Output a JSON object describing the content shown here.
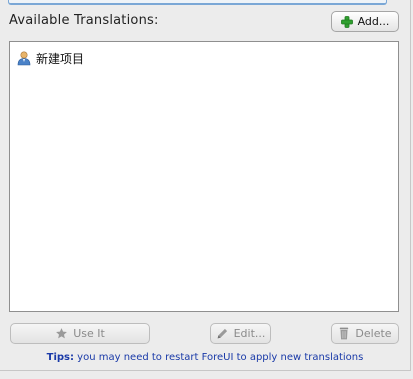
{
  "header": {
    "section_label": "Available Translations:",
    "add_label": "Add..."
  },
  "translations": {
    "items": [
      {
        "label": "新建项目",
        "icon": "user-icon"
      }
    ]
  },
  "actions": {
    "use_label": "Use It",
    "edit_label": "Edit...",
    "delete_label": "Delete"
  },
  "tips": {
    "prefix": "Tips:",
    "text": " you may need to restart ForeUI to apply new translations"
  },
  "colors": {
    "accent": "#7aa7d6",
    "tips_text": "#1a3aa8",
    "add_icon": "#2fa02f"
  }
}
